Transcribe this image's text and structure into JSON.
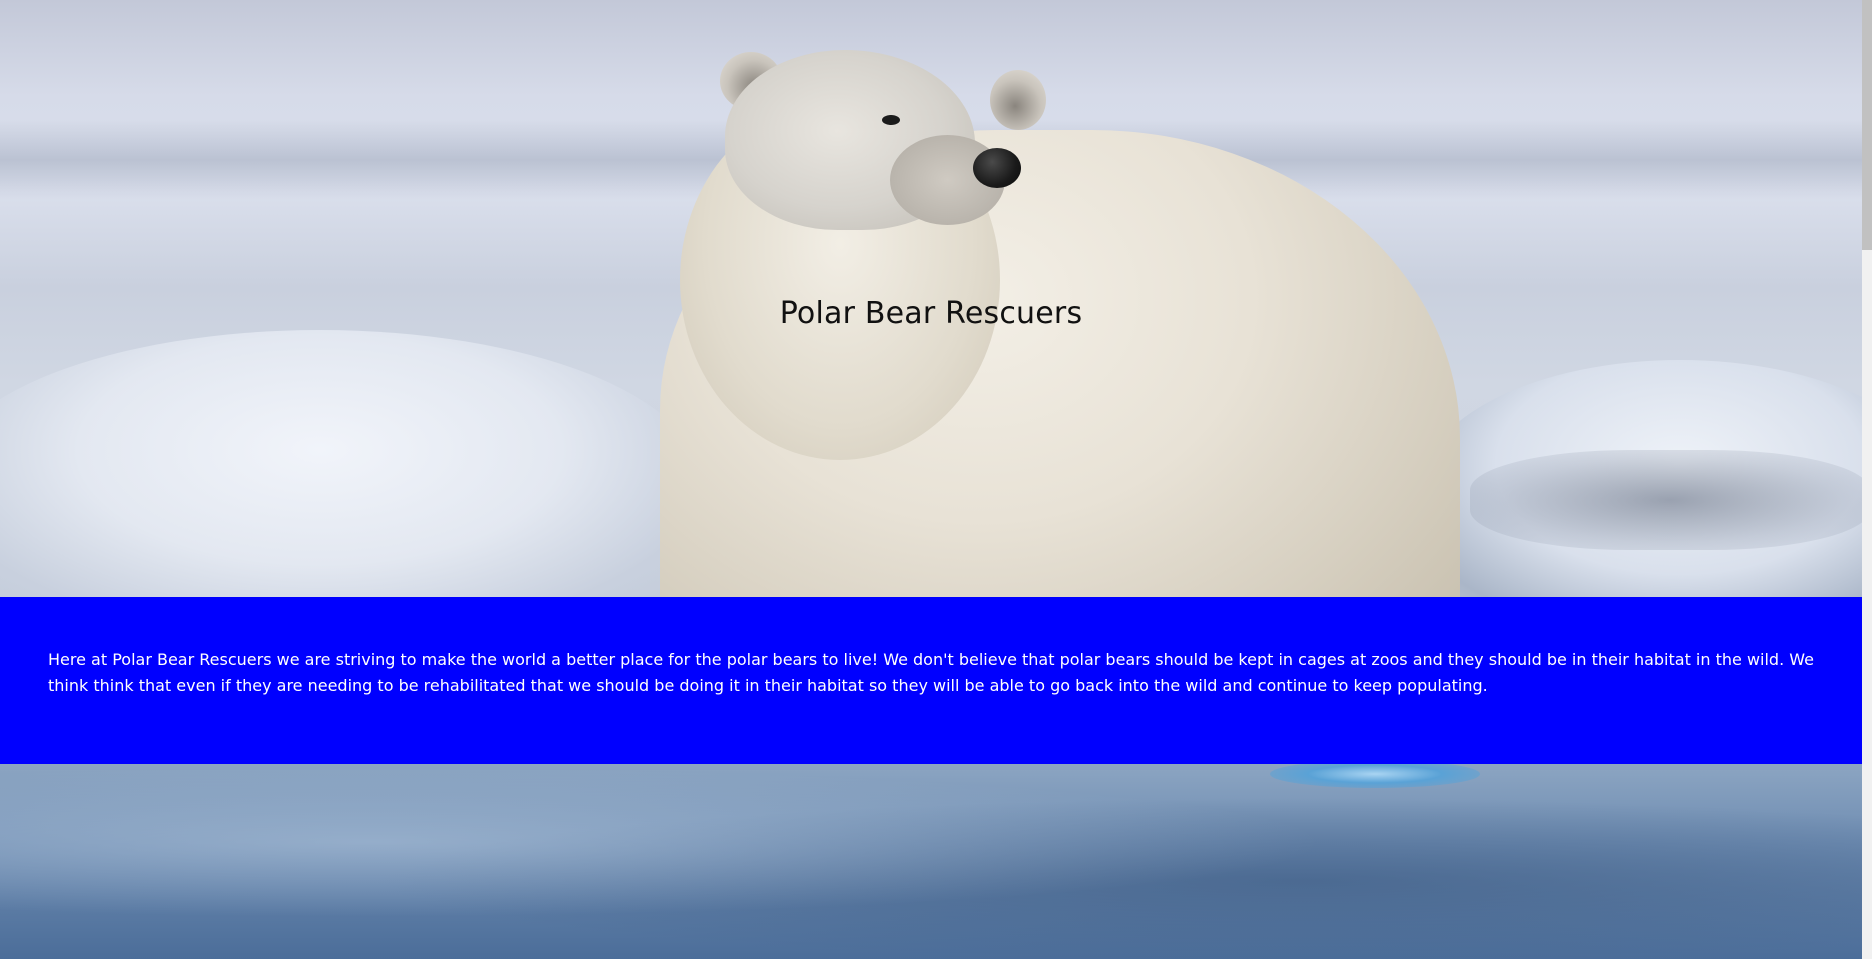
{
  "hero": {
    "title": "Polar Bear Rescuers",
    "background_icon": "polar-bear-photo"
  },
  "info": {
    "text": "Here at Polar Bear Rescuers we are striving to make the world a better place for the polar bears to live! We don't believe that polar bears should be kept in cages at zoos and they should be in their habitat in the wild. We think think that even if they are needing to be rehabilitated that we should be doing it in their habitat so they will be able to go back into the wild and continue to keep populating.",
    "background_color": "#0000ff",
    "text_color": "#ffffff"
  }
}
